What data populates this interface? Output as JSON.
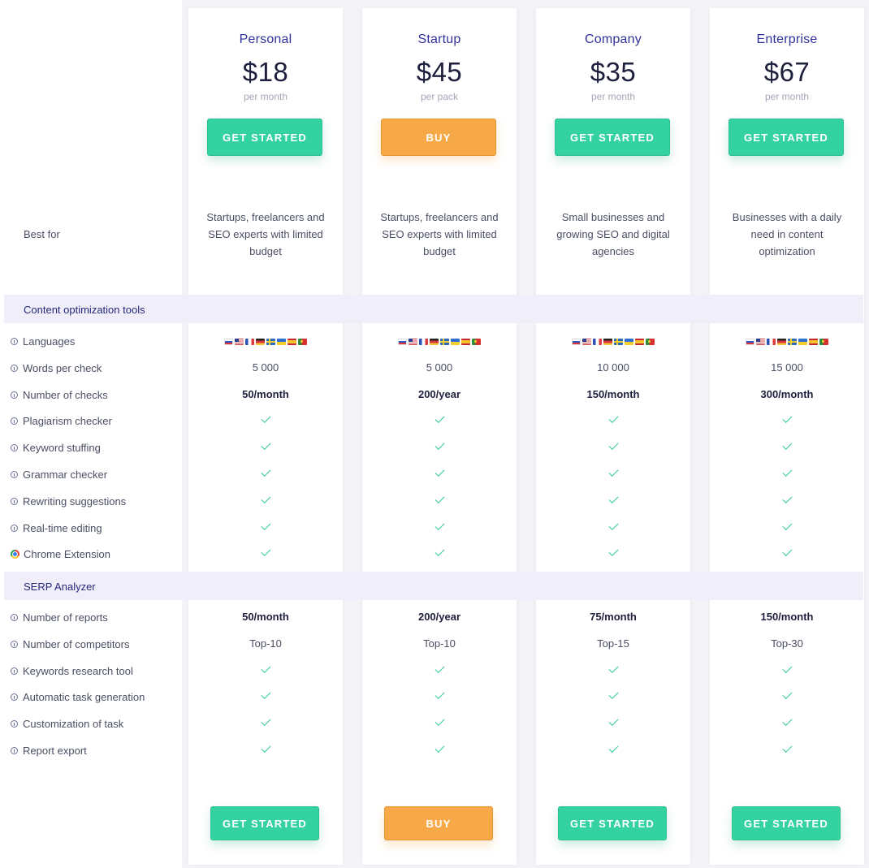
{
  "plans": [
    {
      "name": "Personal",
      "price": "$18",
      "period": "per month",
      "cta": "GET STARTED",
      "best_for": "Startups, freelancers and SEO experts with limited budget"
    },
    {
      "name": "Startup",
      "price": "$45",
      "period": "per pack",
      "cta": "BUY",
      "best_for": "Startups, freelancers and SEO experts with limited budget"
    },
    {
      "name": "Company",
      "price": "$35",
      "period": "per month",
      "cta": "GET STARTED",
      "best_for": "Small businesses and growing SEO and digital agencies"
    },
    {
      "name": "Enterprise",
      "price": "$67",
      "period": "per month",
      "cta": "GET STARTED",
      "best_for": "Businesses with a daily need in content optimization"
    }
  ],
  "best_for_label": "Best for",
  "sections": [
    {
      "title": "Content optimization tools",
      "rows": [
        {
          "label": "Languages",
          "icon": "info-icon",
          "type": "flags",
          "values": [
            "",
            "",
            "",
            ""
          ]
        },
        {
          "label": "Words per check",
          "icon": "info-icon",
          "type": "text",
          "values": [
            "5 000",
            "5 000",
            "10 000",
            "15 000"
          ]
        },
        {
          "label": "Number of checks",
          "icon": "info-icon",
          "type": "bold",
          "values": [
            "50/month",
            "200/year",
            "150/month",
            "300/month"
          ]
        },
        {
          "label": "Plagiarism checker",
          "icon": "info-icon",
          "type": "check",
          "values": [
            "",
            "",
            "",
            ""
          ]
        },
        {
          "label": "Keyword stuffing",
          "icon": "info-icon",
          "type": "check",
          "values": [
            "",
            "",
            "",
            ""
          ]
        },
        {
          "label": "Grammar checker",
          "icon": "info-icon",
          "type": "check",
          "values": [
            "",
            "",
            "",
            ""
          ]
        },
        {
          "label": "Rewriting suggestions",
          "icon": "info-icon",
          "type": "check",
          "values": [
            "",
            "",
            "",
            ""
          ]
        },
        {
          "label": "Real-time editing",
          "icon": "info-icon",
          "type": "check",
          "values": [
            "",
            "",
            "",
            ""
          ]
        },
        {
          "label": "Chrome Extension",
          "icon": "chrome-icon",
          "type": "check",
          "values": [
            "",
            "",
            "",
            ""
          ]
        }
      ]
    },
    {
      "title": "SERP Analyzer",
      "rows": [
        {
          "label": "Number of reports",
          "icon": "info-icon",
          "type": "bold",
          "values": [
            "50/month",
            "200/year",
            "75/month",
            "150/month"
          ]
        },
        {
          "label": "Number of competitors",
          "icon": "info-icon",
          "type": "text",
          "values": [
            "Top-10",
            "Top-10",
            "Top-15",
            "Top-30"
          ]
        },
        {
          "label": "Keywords research tool",
          "icon": "info-icon",
          "type": "check",
          "values": [
            "",
            "",
            "",
            ""
          ]
        },
        {
          "label": "Automatic task generation",
          "icon": "info-icon",
          "type": "check",
          "values": [
            "",
            "",
            "",
            ""
          ]
        },
        {
          "label": "Customization of task",
          "icon": "info-icon",
          "type": "check",
          "values": [
            "",
            "",
            "",
            ""
          ]
        },
        {
          "label": "Report export",
          "icon": "info-icon",
          "type": "check",
          "values": [
            "",
            "",
            "",
            ""
          ]
        }
      ]
    }
  ],
  "language_flags": [
    "ru-flag",
    "us-flag",
    "fr-flag",
    "de-flag",
    "se-flag",
    "ua-flag",
    "es-flag",
    "pt-flag"
  ],
  "colors": {
    "accent_green": "#35d2a1",
    "accent_orange": "#f7a948",
    "plan_name": "#32319a",
    "section_band": "#efeef9"
  }
}
